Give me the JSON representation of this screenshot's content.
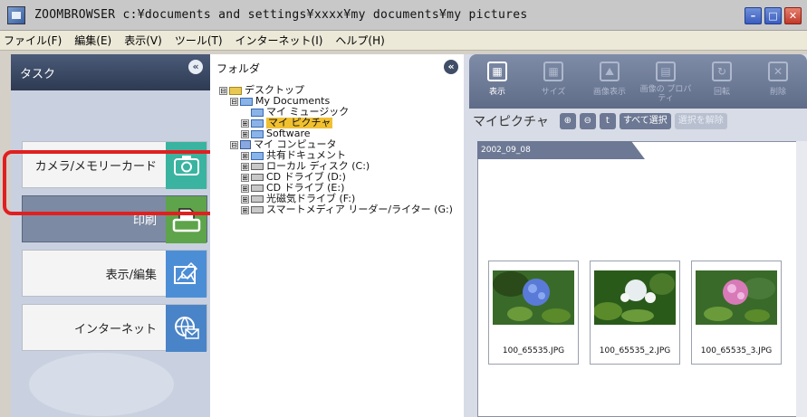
{
  "window": {
    "title": "ZOOMBROWSER c:¥documents and settings¥xxxx¥my documents¥my pictures",
    "min": "–",
    "max": "□",
    "close": "✕"
  },
  "menu": [
    "ファイル(F)",
    "編集(E)",
    "表示(V)",
    "ツール(T)",
    "インターネット(I)",
    "ヘルプ(H)"
  ],
  "task_panel": {
    "title": "タスク",
    "collapse": "«",
    "items": [
      {
        "label": "カメラ/メモリーカード",
        "icon": "camera-icon"
      },
      {
        "label": "印刷",
        "icon": "printer-icon"
      },
      {
        "label": "表示/編集",
        "icon": "edit-icon"
      },
      {
        "label": "インターネット",
        "icon": "globe-mail-icon"
      }
    ]
  },
  "folder_panel": {
    "title": "フォルダ",
    "collapse": "«",
    "tree": [
      {
        "expander": "⊟",
        "label": "デスクトップ"
      },
      {
        "expander": "⊟",
        "label": "My Documents"
      },
      {
        "expander": "",
        "label": "マイ ミュージック"
      },
      {
        "expander": "⊞",
        "label": "マイ ピクチャ"
      },
      {
        "expander": "⊞",
        "label": "Software"
      },
      {
        "expander": "⊟",
        "label": "マイ コンピュータ"
      },
      {
        "expander": "⊞",
        "label": "共有ドキュメント"
      },
      {
        "expander": "⊞",
        "label": "ローカル ディスク (C:)"
      },
      {
        "expander": "⊞",
        "label": "CD ドライブ (D:)"
      },
      {
        "expander": "⊞",
        "label": "CD ドライブ (E:)"
      },
      {
        "expander": "⊞",
        "label": "光磁気ドライブ (F:)"
      },
      {
        "expander": "⊞",
        "label": "スマートメディア リーダー/ライター (G:)"
      }
    ]
  },
  "toolbar": {
    "tools": [
      {
        "label": "表示",
        "glyph": "▦"
      },
      {
        "label": "サイズ",
        "glyph": "▦"
      },
      {
        "label": "画像表示",
        "glyph": "⛰"
      },
      {
        "label": "画像の プロパティ",
        "glyph": "▤"
      },
      {
        "label": "回転",
        "glyph": "↻"
      },
      {
        "label": "削除",
        "glyph": "✕"
      }
    ]
  },
  "view": {
    "title": "マイピクチャ",
    "zoom_in": "⊕",
    "zoom_out": "⊖",
    "up": "t",
    "select_all": "すべて選択",
    "deselect_all": "選択を解除",
    "date_tab": "2002_09_08"
  },
  "thumbnails": [
    {
      "caption": "100_65535.JPG",
      "color": "#5a7ad8"
    },
    {
      "caption": "100_65535_2.JPG",
      "color": "#e8eef0"
    },
    {
      "caption": "100_65535_3.JPG",
      "color": "#d87ab8"
    }
  ]
}
